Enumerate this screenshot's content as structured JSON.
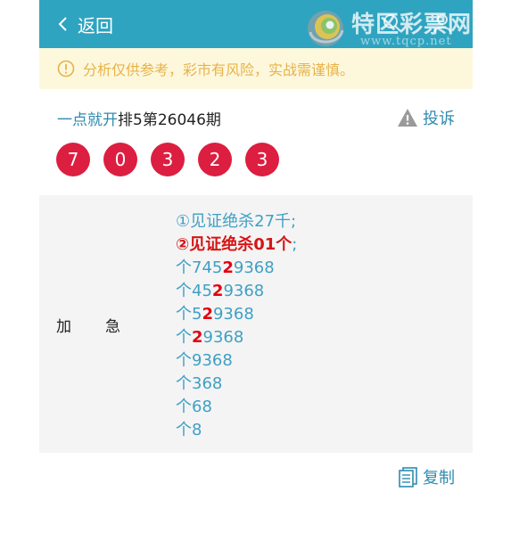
{
  "header": {
    "back_label": "返回",
    "logo_text": "特区彩票网",
    "logo_url": "www.tqcp.net"
  },
  "notice": {
    "text": "分析仅供参考，彩市有风险，实战需谨慎。"
  },
  "info": {
    "author": "一点就开",
    "issue": "排5第26046期",
    "report_label": "投诉"
  },
  "balls": [
    "7",
    "0",
    "3",
    "2",
    "3"
  ],
  "prediction": {
    "label_1": "加",
    "label_2": "急",
    "line_1": "①见证绝杀27千;",
    "line_2_main": "②见证绝杀01个",
    "line_2_semi": ";",
    "rows": [
      {
        "pre": "个745",
        "hl": "2",
        "post": "9368"
      },
      {
        "pre": "个45",
        "hl": "2",
        "post": "9368"
      },
      {
        "pre": "个5",
        "hl": "2",
        "post": "9368"
      },
      {
        "pre": "个",
        "hl": "2",
        "post": "9368"
      },
      {
        "pre": "个9368",
        "hl": "",
        "post": ""
      },
      {
        "pre": "个368",
        "hl": "",
        "post": ""
      },
      {
        "pre": "个68",
        "hl": "",
        "post": ""
      },
      {
        "pre": "个8",
        "hl": "",
        "post": ""
      }
    ]
  },
  "copy": {
    "label": "复制"
  },
  "colors": {
    "header": "#2fa4c0",
    "ball": "#dc1e41",
    "link": "#2e8bb0",
    "highlight": "#e3000f"
  }
}
